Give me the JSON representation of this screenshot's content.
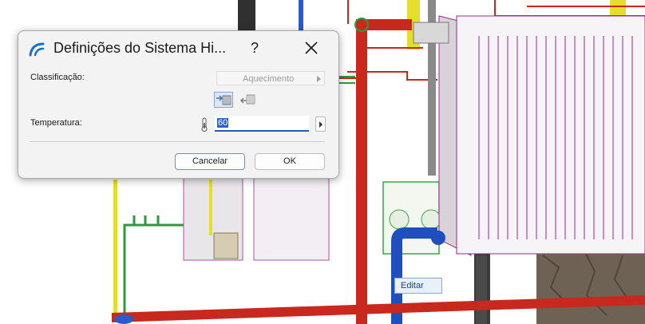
{
  "dialog": {
    "title": "Definições do Sistema Hi...",
    "help_label": "?",
    "classification_label": "Classificação:",
    "classification_value": "Aquecimento",
    "temperature_label": "Temperatura:",
    "temperature_value": "60",
    "cancel_label": "Cancelar",
    "ok_label": "OK"
  },
  "viewport": {
    "tooltip_label": "Editar"
  },
  "colors": {
    "accent": "#2d64c9",
    "supply_pipe": "#c8281e",
    "return_pipe": "#1f4fbf",
    "radiator_edges": "#9b2a8f",
    "gas_pipe": "#e4de2e",
    "drain_pipe": "#2f9a3c"
  },
  "icons": [
    "app-logo-icon",
    "close-icon",
    "heating-mode-icon",
    "cooling-mode-icon",
    "thermometer-icon",
    "stepper-arrow-icon"
  ]
}
